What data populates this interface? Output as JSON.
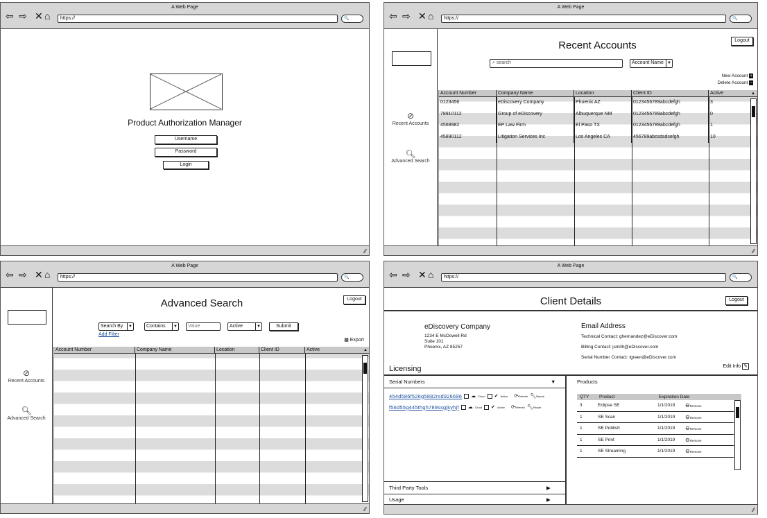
{
  "chrome": {
    "title": "A Web Page",
    "url": "https://",
    "search_glyph": "🔍"
  },
  "login": {
    "app_title": "Product Authorization Manager",
    "username_placeholder": "Username",
    "password_placeholder": "Password",
    "login_label": "Login"
  },
  "sidebar": {
    "recent": "Recent Accounts",
    "advanced": "Advanced Search"
  },
  "recent": {
    "title": "Recent Accounts",
    "logout": "Logout",
    "search_placeholder": "search",
    "filter_select": "Account Name",
    "new_account": "New Account",
    "delete_account": "Delete Account",
    "columns": [
      "Account Number",
      "Company Name",
      "Location",
      "Client ID",
      "Active"
    ],
    "rows": [
      [
        "0123456",
        "eDiscovery Company",
        "Phoenix AZ",
        "0123456789abcdefgh",
        "3"
      ],
      [
        "78910112",
        "Group of eDiscovery",
        "Albuquerque NM",
        "0123456789abcdefgh",
        "0"
      ],
      [
        "4568982",
        "EP Law Firm",
        "El Paso TX",
        "0123456789abcdefgh",
        "1"
      ],
      [
        "45890112",
        "Litigation Services Inc",
        "Los Angeles CA",
        "456789abcsdsdsefgh",
        "10"
      ]
    ]
  },
  "advanced": {
    "title": "Advanced Search",
    "logout": "Logout",
    "search_by": "Search By",
    "contains": "Contains",
    "value_placeholder": "Value",
    "active": "Active",
    "submit": "Submit",
    "add_filter": "Add Filter",
    "export": "Export",
    "columns": [
      "Account Number",
      "Company Name",
      "Location",
      "Client ID",
      "Active"
    ]
  },
  "client": {
    "title": "Client Details",
    "logout": "Logout",
    "company": "eDiscovery Company",
    "address": [
      "1234 E McDowell Rd",
      "Suite 101",
      "Phoenix, AZ 85257"
    ],
    "email_heading": "Email Address",
    "contacts": [
      "Technical Contact: ghernandez@eDiscover.com",
      "Billing Contact: jsmith@eDiscover.com",
      "Serial Number Contact: tgreen@eDiscover.com"
    ],
    "licensing": "Licensing",
    "edit_info": "Edit Info",
    "serial_numbers": "Serial Numbers",
    "products": "Products",
    "serials": [
      "454d586f526g5882rsd926696",
      "f56d55g445thgh789ssgjkyhjf"
    ],
    "serial_actions": {
      "cloud": "Cloud",
      "active": "Active",
      "refresh": "Refresh",
      "repair": "Repair"
    },
    "product_columns": [
      "QTY",
      "Product",
      "Expiration Date"
    ],
    "product_rows": [
      [
        "3",
        "Eclipse SE",
        "1/1/2019"
      ],
      [
        "1",
        "SE Scan",
        "1/1/2019"
      ],
      [
        "1",
        "SE Publish",
        "1/1/2019"
      ],
      [
        "1",
        "SE Print",
        "1/1/2019"
      ],
      [
        "1",
        "SE Streaming",
        "1/1/2019"
      ]
    ],
    "remove": "Remove",
    "third_party": "Third Party Tools",
    "usage": "Usage"
  }
}
